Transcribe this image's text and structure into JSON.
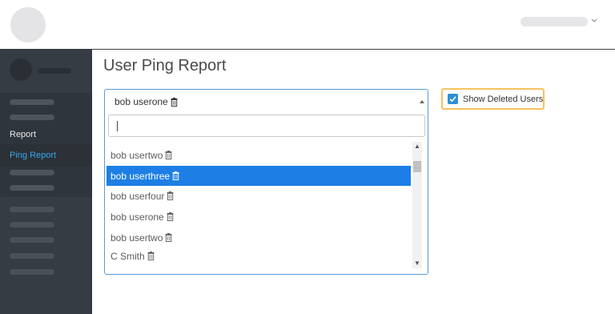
{
  "page": {
    "title": "User Ping Report"
  },
  "sidebar": {
    "items": [
      {
        "label": "Report",
        "active": false
      },
      {
        "label": "Ping Report",
        "active": true
      }
    ]
  },
  "user_select": {
    "selected": "bob userone",
    "search_value": "",
    "options": [
      {
        "label": "bob usertwo",
        "highlighted": false
      },
      {
        "label": "bob userthree",
        "highlighted": true
      },
      {
        "label": "bob userfour",
        "highlighted": false
      },
      {
        "label": "bob userone",
        "highlighted": false
      },
      {
        "label": "bob usertwo",
        "highlighted": false
      },
      {
        "label": "C Smith",
        "highlighted": false
      }
    ]
  },
  "show_deleted": {
    "label": "Show Deleted Users",
    "checked": true
  },
  "colors": {
    "accent": "#1d7fe5",
    "sidebar": "#363c44",
    "checkbox_border": "#f4c261",
    "link_active": "#35a6e8"
  },
  "icons": {
    "option_icon": "trash-icon",
    "user_menu": "chevron-down-icon"
  }
}
